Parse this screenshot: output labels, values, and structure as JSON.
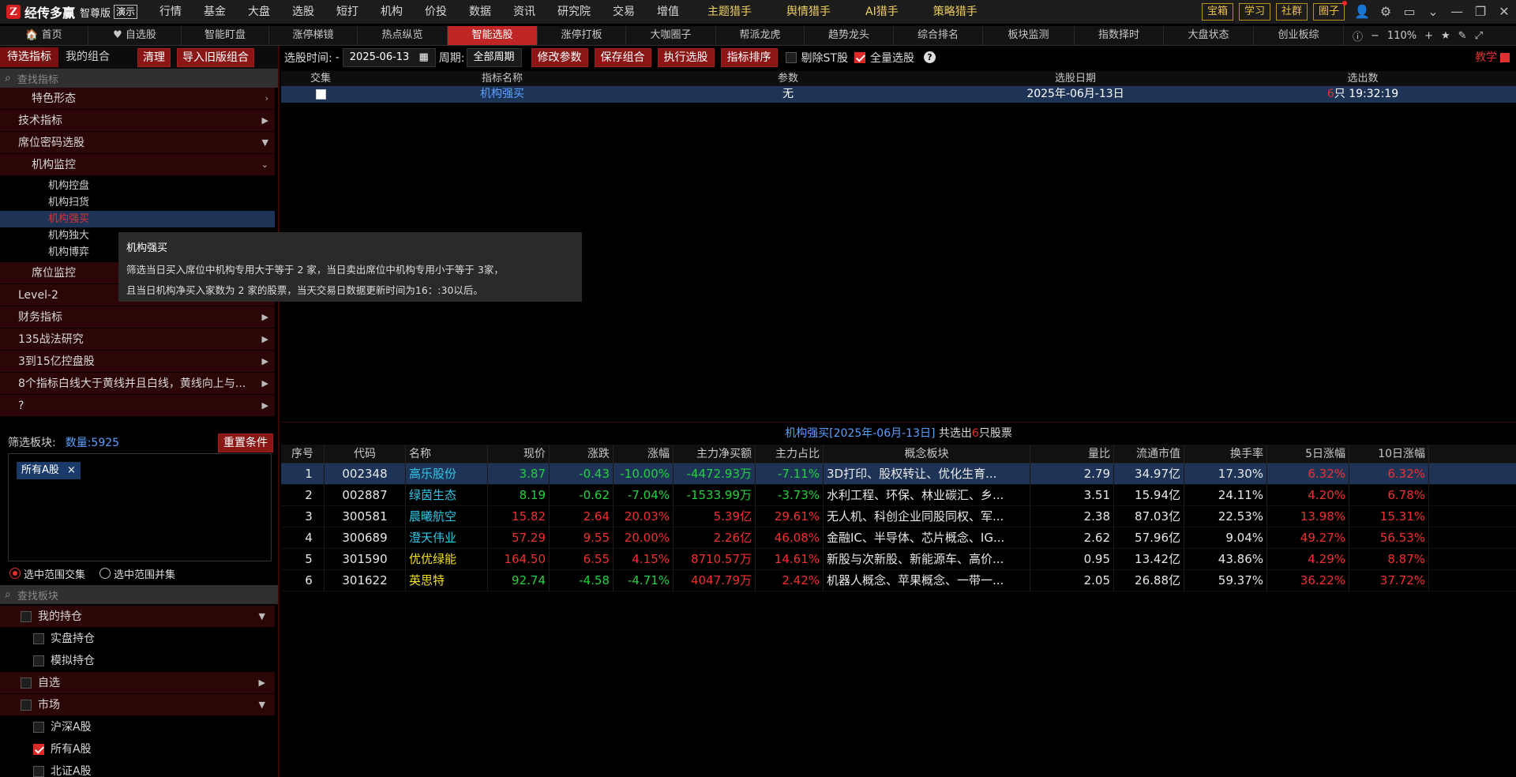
{
  "app": {
    "logo_mark": "Z",
    "name": "经传多赢",
    "edition": "智尊版",
    "demo": "演示"
  },
  "menu": [
    {
      "label": "行情",
      "gold": false,
      "dot": false
    },
    {
      "label": "基金",
      "gold": false,
      "dot": false
    },
    {
      "label": "大盘",
      "gold": false,
      "dot": false
    },
    {
      "label": "选股",
      "gold": false,
      "dot": false
    },
    {
      "label": "短打",
      "gold": false,
      "dot": false
    },
    {
      "label": "机构",
      "gold": false,
      "dot": false
    },
    {
      "label": "价投",
      "gold": false,
      "dot": false
    },
    {
      "label": "数据",
      "gold": false,
      "dot": true
    },
    {
      "label": "资讯",
      "gold": false,
      "dot": false
    },
    {
      "label": "研究院",
      "gold": false,
      "dot": false
    },
    {
      "label": "交易",
      "gold": false,
      "dot": false
    },
    {
      "label": "增值",
      "gold": false,
      "dot": false
    },
    {
      "label": "主题猎手",
      "gold": true,
      "dot": false
    },
    {
      "label": "舆情猎手",
      "gold": true,
      "dot": false
    },
    {
      "label": "AI猎手",
      "gold": true,
      "dot": false
    },
    {
      "label": "策略猎手",
      "gold": true,
      "dot": false
    }
  ],
  "top_buttons": [
    {
      "label": "宝箱",
      "dot": false
    },
    {
      "label": "学习",
      "dot": false
    },
    {
      "label": "社群",
      "dot": false
    },
    {
      "label": "圈子",
      "dot": true
    }
  ],
  "nav_tabs": [
    {
      "label": "🏠 首页",
      "w": 112,
      "active": false
    },
    {
      "label": "♥ 自选股",
      "w": 118,
      "active": false
    },
    {
      "label": "智能盯盘",
      "w": 111,
      "active": false
    },
    {
      "label": "涨停梯镜",
      "w": 112,
      "active": false
    },
    {
      "label": "热点纵览",
      "w": 114,
      "active": false
    },
    {
      "label": "智能选股",
      "w": 114,
      "active": true
    },
    {
      "label": "涨停打板",
      "w": 112,
      "active": false
    },
    {
      "label": "大咖圈子",
      "w": 114,
      "active": false
    },
    {
      "label": "帮派龙虎",
      "w": 112,
      "active": false
    },
    {
      "label": "趋势龙头",
      "w": 113,
      "active": false
    },
    {
      "label": "综合排名",
      "w": 113,
      "active": false
    },
    {
      "label": "板块监测",
      "w": 116,
      "active": false
    },
    {
      "label": "指数择时",
      "w": 113,
      "active": false
    },
    {
      "label": "大盘状态",
      "w": 114,
      "active": false
    },
    {
      "label": "创业板综",
      "w": 114,
      "active": false
    }
  ],
  "zoom": {
    "level": "110%"
  },
  "left": {
    "tabs": [
      "待选指标",
      "我的组合"
    ],
    "buttons": [
      "清理",
      "导入旧版组合"
    ],
    "search_placeholder": "查找指标",
    "tree": [
      {
        "label": "特色形态",
        "indent": 40,
        "arrow": "›"
      },
      {
        "label": "技术指标",
        "indent": 23,
        "arrow": "▶"
      },
      {
        "label": "席位密码选股",
        "indent": 23,
        "arrow": "▼"
      },
      {
        "label": "机构监控",
        "indent": 40,
        "arrow": "⌄"
      }
    ],
    "leaves": [
      "机构控盘",
      "机构扫货",
      "机构强买",
      "机构独大",
      "机构博弈"
    ],
    "selected_leaf": 2,
    "tree_after": [
      {
        "label": "席位监控",
        "indent": 40,
        "arrow": ""
      },
      {
        "label": "Level-2",
        "indent": 23,
        "arrow": ""
      },
      {
        "label": "财务指标",
        "indent": 23,
        "arrow": "▶"
      },
      {
        "label": "135战法研究",
        "indent": 23,
        "arrow": "▶"
      },
      {
        "label": "3到15亿控盘股",
        "indent": 23,
        "arrow": "▶"
      },
      {
        "label": "8个指标白线大于黄线并且白线，黄线向上与...",
        "indent": 23,
        "arrow": "▶"
      },
      {
        "label": "?",
        "indent": 23,
        "arrow": "▶"
      }
    ],
    "filter": {
      "label": "筛选板块:",
      "count": "数量:5925",
      "reset": "重置条件",
      "tag": "所有A股",
      "tag_close": "×",
      "radio1": "选中范围交集",
      "radio2": "选中范围并集",
      "search_placeholder": "查找板块"
    },
    "blocks": [
      {
        "label": "我的持仓",
        "level": 0,
        "arrow": "▼",
        "checked": false
      },
      {
        "label": "实盘持仓",
        "level": 1,
        "arrow": "",
        "checked": false
      },
      {
        "label": "模拟持仓",
        "level": 1,
        "arrow": "",
        "checked": false
      },
      {
        "label": "自选",
        "level": 0,
        "arrow": "▶",
        "checked": false
      },
      {
        "label": "市场",
        "level": 0,
        "arrow": "▼",
        "checked": false
      },
      {
        "label": "沪深A股",
        "level": 1,
        "arrow": "",
        "checked": false
      },
      {
        "label": "所有A股",
        "level": 1,
        "arrow": "",
        "checked": true
      },
      {
        "label": "北证A股",
        "level": 1,
        "arrow": "",
        "checked": false
      }
    ]
  },
  "toolbar": {
    "time_label": "选股时间:",
    "date": "2025-06-13",
    "period_label": "周期:",
    "period": "全部周期",
    "buttons": [
      "修改参数",
      "保存组合",
      "执行选股",
      "指标排序"
    ],
    "exclude_st": "剔除ST股",
    "all_stock": "全量选股",
    "help": "?",
    "teach": "教学"
  },
  "indicator_table": {
    "headers": [
      "交集",
      "指标名称",
      "参数",
      "选股日期",
      "选出数"
    ],
    "row": {
      "name": "机构强买",
      "param": "无",
      "date": "2025年-06月-13日",
      "count": "6",
      "count_suffix": "只 19:32:19"
    }
  },
  "tooltip": {
    "title": "机构强买",
    "line1": "筛选当日买入席位中机构专用大于等于 2 家，当日卖出席位中机构专用小于等于 3家，",
    "line2": "且当日机构净买入家数为 2 家的股票，当天交易日数据更新时间为16：:30以后。"
  },
  "result": {
    "title_blue": "机构强买[2025年-06月-13日]",
    "title_mid": "共选出",
    "title_count": "6",
    "title_end": "只股票",
    "headers": [
      "序号",
      "代码",
      "名称",
      "现价",
      "涨跌",
      "涨幅",
      "主力净买额",
      "主力占比",
      "概念板块",
      "量比",
      "流通市值",
      "换手率",
      "5日涨幅",
      "10日涨幅"
    ],
    "rows": [
      {
        "no": "1",
        "code": "002348",
        "name": "高乐股份",
        "price": "3.87",
        "chg": "-0.43",
        "pct": "-10.00%",
        "net": "-4472.93万",
        "ratio": "-7.11%",
        "concept": "3D打印、股权转让、优化生育...",
        "vol": "2.79",
        "cap": "34.97亿",
        "turn": "17.30%",
        "d5": "6.32%",
        "d10": "6.32%",
        "dir": "g",
        "name_color": "cy"
      },
      {
        "no": "2",
        "code": "002887",
        "name": "绿茵生态",
        "price": "8.19",
        "chg": "-0.62",
        "pct": "-7.04%",
        "net": "-1533.99万",
        "ratio": "-3.73%",
        "concept": "水利工程、环保、林业碳汇、乡...",
        "vol": "3.51",
        "cap": "15.94亿",
        "turn": "24.11%",
        "d5": "4.20%",
        "d10": "6.78%",
        "dir": "g",
        "name_color": "cy"
      },
      {
        "no": "3",
        "code": "300581",
        "name": "晨曦航空",
        "price": "15.82",
        "chg": "2.64",
        "pct": "20.03%",
        "net": "5.39亿",
        "ratio": "29.61%",
        "concept": "无人机、科创企业同股同权、军...",
        "vol": "2.38",
        "cap": "87.03亿",
        "turn": "22.53%",
        "d5": "13.98%",
        "d10": "15.31%",
        "dir": "rd",
        "name_color": "cy"
      },
      {
        "no": "4",
        "code": "300689",
        "name": "澄天伟业",
        "price": "57.29",
        "chg": "9.55",
        "pct": "20.00%",
        "net": "2.26亿",
        "ratio": "46.08%",
        "concept": "金融IC、半导体、芯片概念、IG...",
        "vol": "2.62",
        "cap": "57.96亿",
        "turn": "9.04%",
        "d5": "49.27%",
        "d10": "56.53%",
        "dir": "rd",
        "name_color": "cy"
      },
      {
        "no": "5",
        "code": "301590",
        "name": "优优绿能",
        "price": "164.50",
        "chg": "6.55",
        "pct": "4.15%",
        "net": "8710.57万",
        "ratio": "14.61%",
        "concept": "新股与次新股、新能源车、高价...",
        "vol": "0.95",
        "cap": "13.42亿",
        "turn": "43.86%",
        "d5": "4.29%",
        "d10": "8.87%",
        "dir": "rd",
        "name_color": "yl"
      },
      {
        "no": "6",
        "code": "301622",
        "name": "英思特",
        "price": "92.74",
        "chg": "-4.58",
        "pct": "-4.71%",
        "net": "4047.79万",
        "ratio": "2.42%",
        "concept": "机器人概念、苹果概念、一带一...",
        "vol": "2.05",
        "cap": "26.88亿",
        "turn": "59.37%",
        "d5": "36.22%",
        "d10": "37.72%",
        "dir": "g",
        "name_color": "yl"
      }
    ]
  }
}
